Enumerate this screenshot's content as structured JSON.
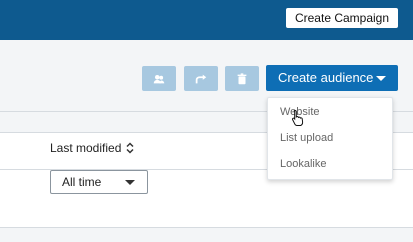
{
  "topbar": {
    "create_campaign_label": "Create Campaign"
  },
  "toolbar": {
    "icons": [
      "users-icon",
      "share-icon",
      "trash-icon"
    ],
    "create_audience_label": "Create audience"
  },
  "table": {
    "column_last_modified": "Last modified",
    "filter_value": "All time"
  },
  "menu": {
    "items": [
      {
        "label": "Website"
      },
      {
        "label": "List upload"
      },
      {
        "label": "Lookalike"
      }
    ]
  },
  "colors": {
    "topbar": "#0e5a8f",
    "primary": "#0e6eb5",
    "disabled": "#a7c8e0"
  }
}
